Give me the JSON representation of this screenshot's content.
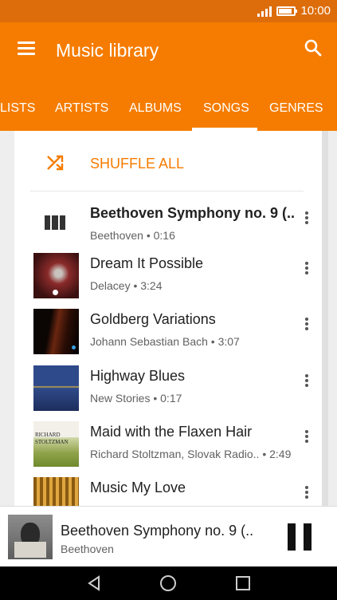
{
  "status": {
    "time": "10:00",
    "battery_level": 0.85
  },
  "app_bar": {
    "title": "Music library",
    "menu_icon": "menu-icon",
    "search_icon": "search-icon"
  },
  "tabs": [
    {
      "label": "LISTS"
    },
    {
      "label": "ARTISTS"
    },
    {
      "label": "ALBUMS"
    },
    {
      "label": "SONGS",
      "selected": true
    },
    {
      "label": "GENRES"
    }
  ],
  "shuffle": {
    "label": "SHUFFLE ALL",
    "icon": "shuffle-icon"
  },
  "songs": [
    {
      "title": "Beethoven Symphony no. 9 (..",
      "subtitle": "Beethoven • 0:16",
      "playing": true,
      "icon": "equalizer-icon"
    },
    {
      "title": "Dream It Possible",
      "subtitle": "Delacey • 3:24"
    },
    {
      "title": "Goldberg Variations",
      "subtitle": "Johann Sebastian Bach • 3:07"
    },
    {
      "title": "Highway Blues",
      "subtitle": "New Stories • 0:17"
    },
    {
      "title": "Maid with the Flaxen Hair",
      "subtitle": "Richard Stoltzman, Slovak Radio.. • 2:49",
      "art_text": [
        "RICHARD",
        "STOLTZMAN"
      ]
    },
    {
      "title": "Music My Love",
      "subtitle": ""
    }
  ],
  "now_playing": {
    "title": "Beethoven Symphony no. 9 (..",
    "artist": "Beethoven",
    "pause_icon": "pause-icon"
  },
  "nav": {
    "back_icon": "back-icon",
    "home_icon": "home-icon",
    "recents_icon": "recents-icon"
  },
  "colors": {
    "accent": "#f57c00",
    "status_bar": "#dd6d0a"
  }
}
